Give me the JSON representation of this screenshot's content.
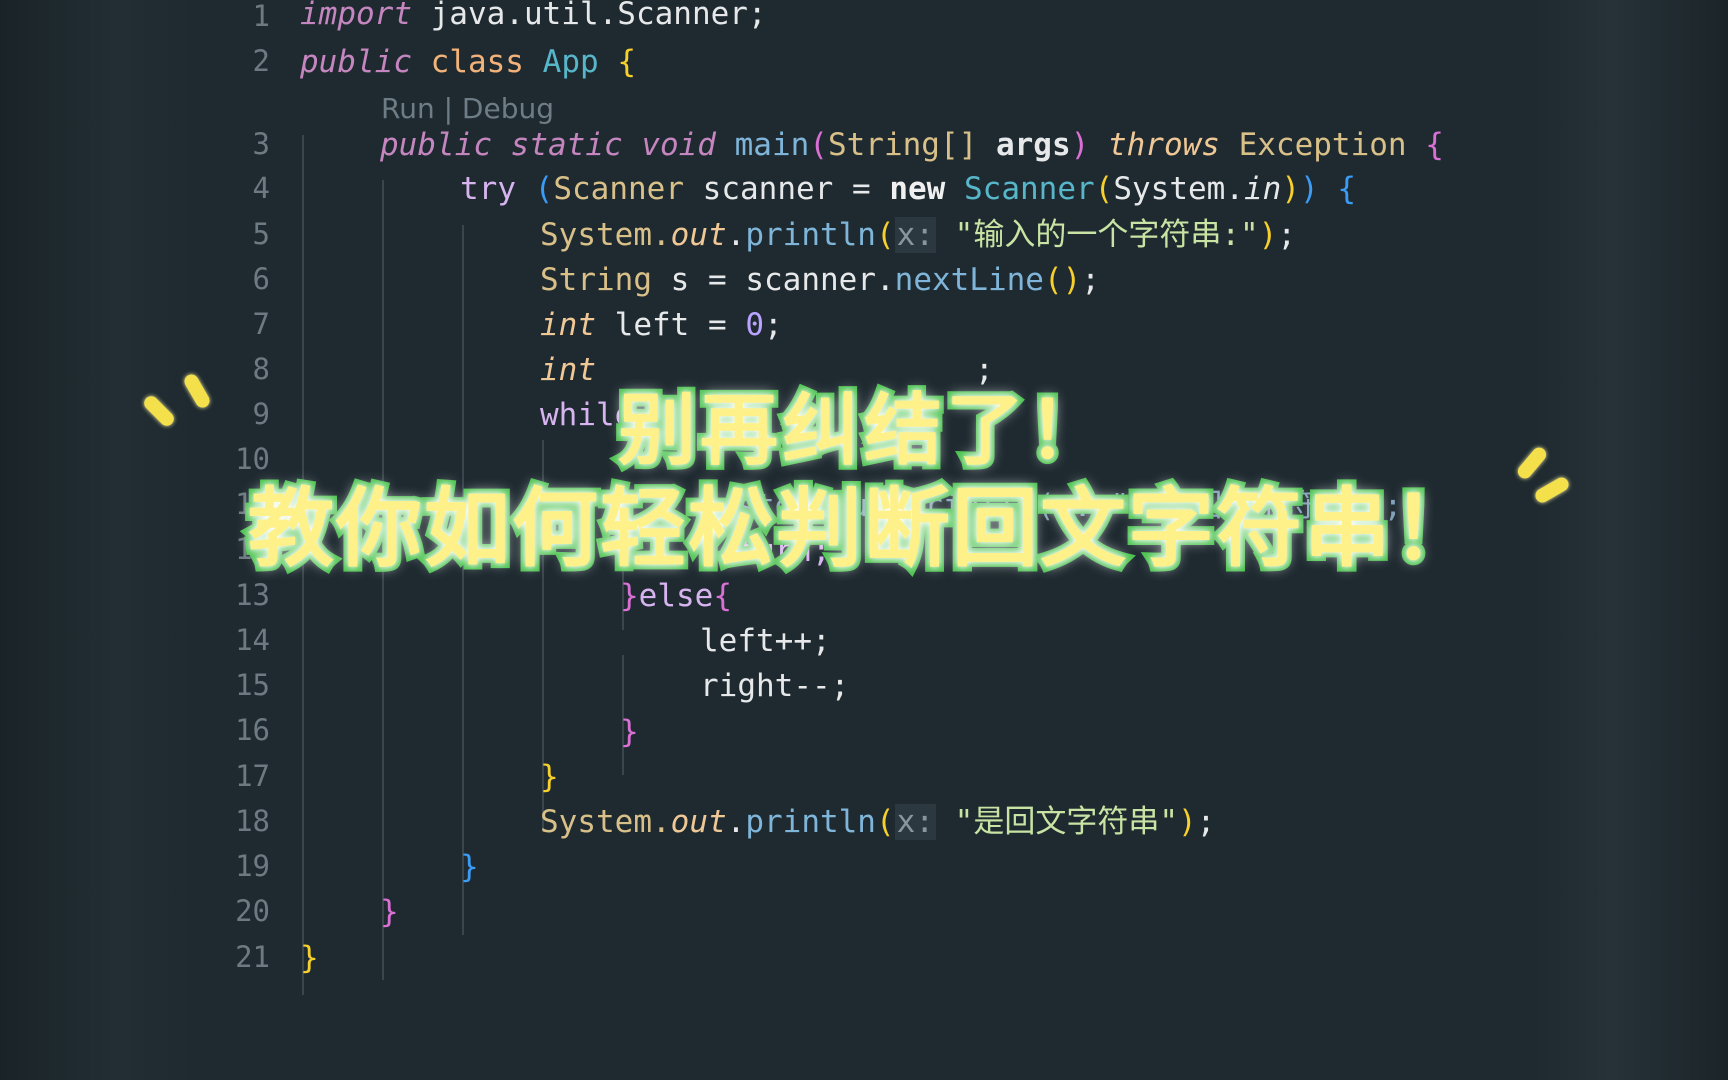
{
  "editor": {
    "codelens": "Run | Debug",
    "lines": [
      {
        "n": "1"
      },
      {
        "n": "2"
      },
      {
        "n": "3"
      },
      {
        "n": "4"
      },
      {
        "n": "5"
      },
      {
        "n": "6"
      },
      {
        "n": "7"
      },
      {
        "n": "8"
      },
      {
        "n": "9"
      },
      {
        "n": "10"
      },
      {
        "n": "11"
      },
      {
        "n": "12"
      },
      {
        "n": "13"
      },
      {
        "n": "14"
      },
      {
        "n": "15"
      },
      {
        "n": "16"
      },
      {
        "n": "17"
      },
      {
        "n": "18"
      },
      {
        "n": "19"
      },
      {
        "n": "20"
      },
      {
        "n": "21"
      }
    ],
    "code": {
      "l1_import": "import",
      "l1_pkg": " java.util.Scanner;",
      "l2_public": "public",
      "l2_class": "class",
      "l2_name": "App",
      "l3_public": "public",
      "l3_static": "static",
      "l3_void": "void",
      "l3_main": "main",
      "l3_stringarr": "String[]",
      "l3_args": "args",
      "l3_throws": "throws",
      "l3_exception": "Exception",
      "l4_try": "try",
      "l4_scanner_type": "Scanner",
      "l4_scanner_var": "scanner",
      "l4_new": "new",
      "l4_scanner_ctor": "Scanner",
      "l4_system": "System.",
      "l4_in": "in",
      "l5_system": "System.",
      "l5_out": "out",
      "l5_println": "println",
      "l5_hint": "x:",
      "l5_str": "\"输入的一个字符串:\"",
      "l6_string": "String",
      "l6_s": "s",
      "l6_scanner": "scanner.",
      "l6_nextline": "nextLine",
      "l7_int": "int",
      "l7_left": "left",
      "l7_zero": "0",
      "l8_int": "int",
      "l9_while": "while",
      "l11_system": "System.out.println(x: \"不是回文字符串\");",
      "l12_return": "return;",
      "l13_else": "else",
      "l14_left": "left++;",
      "l15_right": "right--;",
      "l18_system": "System.",
      "l18_out": "out",
      "l18_println": "println",
      "l18_hint": "x:",
      "l18_str": "\"是回文字符串\""
    }
  },
  "overlay": {
    "line1": "别再纠结了！",
    "line2": "教你如何轻松判断回文字符串！"
  },
  "colors": {
    "background": "#1e2a30",
    "keyword": "#c586c0",
    "string": "#c8e3a3",
    "overlay_fill": "#fff18a",
    "overlay_stroke": "#47c24b"
  }
}
